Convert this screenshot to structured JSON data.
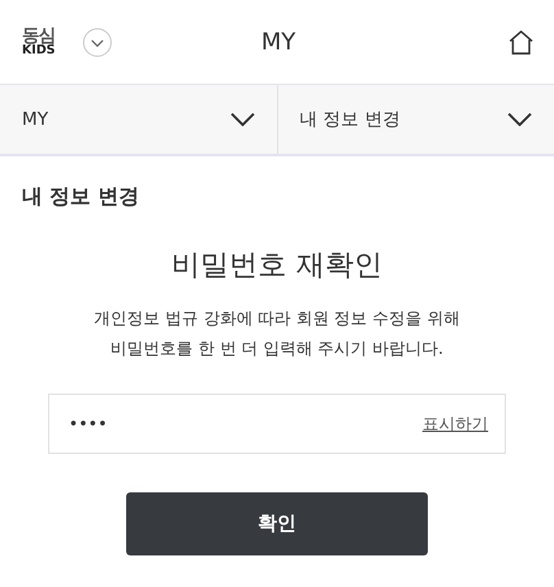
{
  "header": {
    "logo": {
      "top": "동심",
      "bottom": "KIDS"
    },
    "title": "MY"
  },
  "breadcrumbs": [
    {
      "label": "MY"
    },
    {
      "label": "내 정보 변경"
    }
  ],
  "page_title": "내 정보 변경",
  "heading": "비밀번호 재확인",
  "description": [
    "개인정보 법규 강화에 따라 회원 정보 수정을 위해",
    "비밀번호를 한 번 더 입력해 주시기 바랍니다."
  ],
  "password": {
    "value": "••••",
    "toggle": "표시하기"
  },
  "submit": "확인"
}
